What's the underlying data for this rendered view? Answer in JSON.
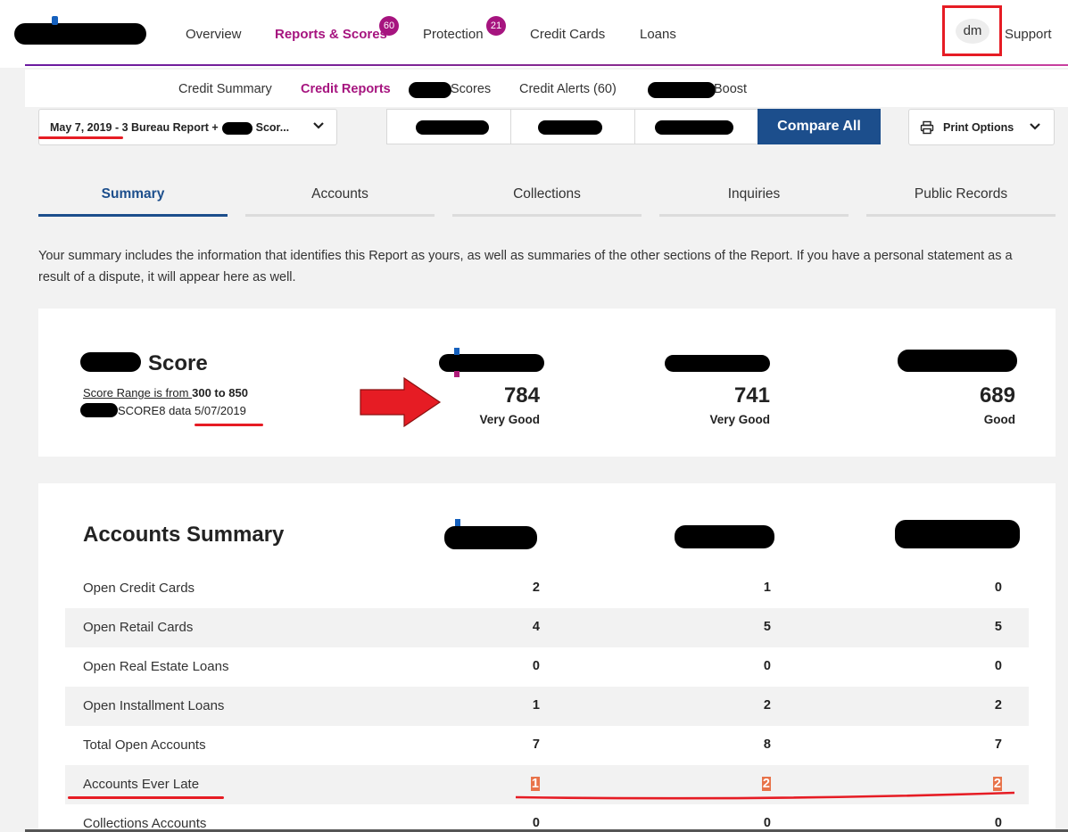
{
  "nav": {
    "items": [
      {
        "label": "Overview"
      },
      {
        "label": "Reports & Scores",
        "badge": "60"
      },
      {
        "label": "Protection",
        "badge": "21"
      },
      {
        "label": "Credit Cards"
      },
      {
        "label": "Loans"
      }
    ],
    "user_initials": "dm",
    "support": "Support"
  },
  "subnav": {
    "credit_summary": "Credit Summary",
    "credit_reports": "Credit Reports",
    "scores": "Scores",
    "credit_alerts": "Credit Alerts  (60)",
    "boost": "Boost"
  },
  "report_selector": {
    "date": "May 7, 2019 - ",
    "text": "3 Bureau Report +",
    "suffix": "Scor..."
  },
  "compare_all": "Compare All",
  "print_options": "Print Options",
  "tabs": [
    "Summary",
    "Accounts",
    "Collections",
    "Inquiries",
    "Public Records"
  ],
  "summary_text": "Your summary includes the information that identifies this Report as yours, as well as summaries of the other sections of the Report. If you have a personal statement as a result of a dispute, it will appear here as well.",
  "score_card": {
    "title": "Score",
    "range_prefix": "Score Range is from ",
    "range_value": "300 to 850",
    "data_prefix": "SCORE8 data ",
    "data_date": "5/07/2019",
    "scores": [
      {
        "value": "784",
        "label": "Very Good"
      },
      {
        "value": "741",
        "label": "Very Good"
      },
      {
        "value": "689",
        "label": "Good"
      }
    ]
  },
  "accounts_summary": {
    "title": "Accounts Summary",
    "rows": [
      {
        "label": "Open Credit Cards",
        "values": [
          "2",
          "1",
          "0"
        ]
      },
      {
        "label": "Open Retail Cards",
        "values": [
          "4",
          "5",
          "5"
        ]
      },
      {
        "label": "Open Real Estate Loans",
        "values": [
          "0",
          "0",
          "0"
        ]
      },
      {
        "label": "Open Installment Loans",
        "values": [
          "1",
          "2",
          "2"
        ]
      },
      {
        "label": "Total Open Accounts",
        "values": [
          "7",
          "8",
          "7"
        ]
      },
      {
        "label": "Accounts Ever Late",
        "values": [
          "1",
          "2",
          "2"
        ]
      },
      {
        "label": "Collections Accounts",
        "values": [
          "0",
          "0",
          "0"
        ]
      }
    ]
  },
  "colors": {
    "brand_purple": "#a6147f",
    "primary_blue": "#1c4e8c",
    "annotation_red": "#e61c24"
  }
}
